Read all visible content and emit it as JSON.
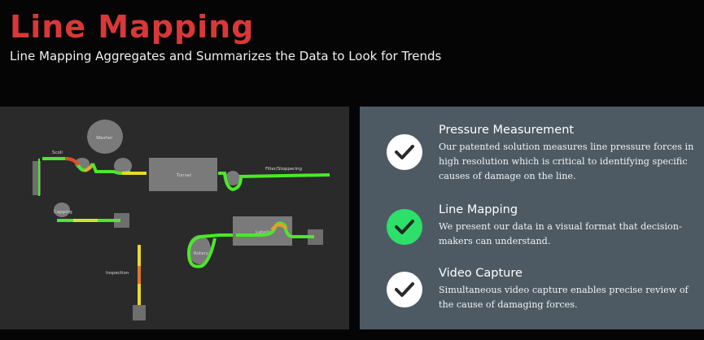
{
  "header": {
    "title": "Line Mapping",
    "subtitle": "Line Mapping Aggregates and Summarizes the Data to Look for Trends"
  },
  "map": {
    "labels": {
      "washer": "Washer",
      "scoll": "Scoll",
      "tunnel": "Tunnel",
      "filler": "Filler/Stoppering",
      "capping": "Capping",
      "labeller": "Labeller",
      "rotary": "Rotary",
      "inspection": "Inspection"
    }
  },
  "features": [
    {
      "title": "Pressure Measurement",
      "description": "Our patented solution measures line pressure forces in high resolution which is critical to identifying specific causes of damage on the line.",
      "icon": "check-icon",
      "active": false
    },
    {
      "title": "Line Mapping",
      "description": "We present our data in a visual format that decision-makers can understand.",
      "icon": "check-icon",
      "active": true
    },
    {
      "title": "Video Capture",
      "description": "Simultaneous video capture enables precise review of the cause of damaging forces.",
      "icon": "check-icon",
      "active": false
    }
  ],
  "colors": {
    "title": "#d93838",
    "panel": "#4d5a64",
    "check_active": "#2ce06a",
    "line_ok": "#4ce82a",
    "line_warn": "#e8d82a",
    "line_alert": "#e04a2a"
  }
}
